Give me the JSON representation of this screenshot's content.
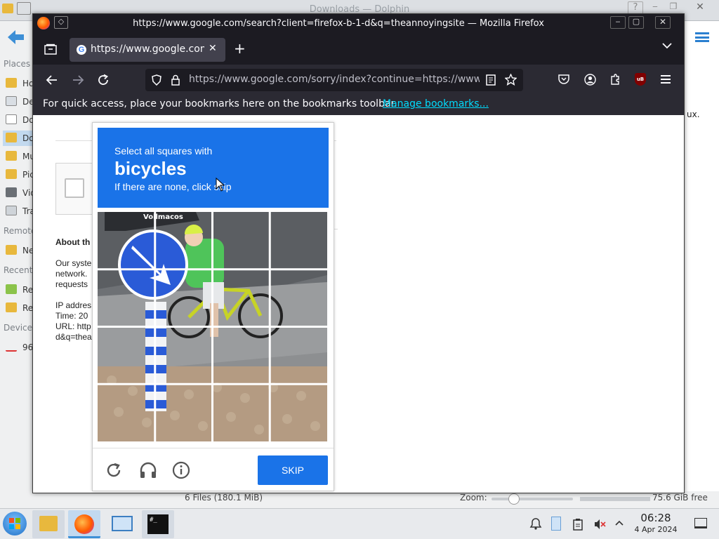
{
  "dolphin": {
    "title": "Downloads — Dolphin",
    "places_label": "Places",
    "remote_label": "Remote",
    "recent_label": "Recent",
    "devices_label": "Devices",
    "places": [
      "Ho",
      "Des",
      "Do",
      "Do",
      "Mu",
      "Pic",
      "Vid",
      "Tra"
    ],
    "remote": [
      "Ne"
    ],
    "recent": [
      "Rec",
      "Rec"
    ],
    "devices": [
      "96"
    ],
    "right_text": "ux.",
    "status_files": "6 Files (180.1 MiB)",
    "status_zoom": "Zoom:",
    "status_free": "75.6 GiB free"
  },
  "firefox": {
    "window_title": "https://www.google.com/search?client=firefox-b-1-d&q=theannoyingsite — Mozilla Firefox",
    "tab_title": "https://www.google.com/",
    "url": "https://www.google.com/sorry/index?continue=https://www",
    "bookmarks_hint": "For quick access, place your bookmarks here on the bookmarks toolbar.",
    "manage_bookmarks": "Manage bookmarks...",
    "ublock_label": "uB"
  },
  "google_sorry": {
    "about_heading": "About th",
    "body_lines": [
      "Our syste",
      "network.",
      "requests"
    ],
    "ip_line": "IP addres",
    "time_line": "Time: 20",
    "url_line": "URL: http",
    "query_line": "d&q=thea"
  },
  "captcha": {
    "instruction": "Select all squares with",
    "target": "bicycles",
    "hint": "If there are none, click skip",
    "skip_label": "SKIP",
    "grid_rows": 4,
    "grid_cols": 4,
    "sign_text": "Vollmacos"
  },
  "taskbar": {
    "time": "06:28",
    "date": "4 Apr 2024",
    "terminal_label": "#_"
  },
  "colors": {
    "captcha_blue": "#1a73e8",
    "firefox_dark": "#1c1b22",
    "firefox_toolbar": "#2b2a33",
    "link": "#00ddff"
  }
}
